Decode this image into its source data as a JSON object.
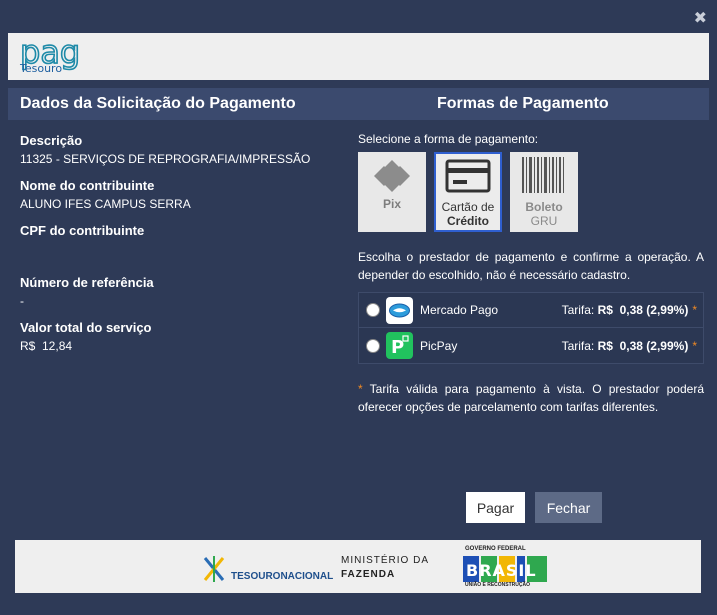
{
  "window": {
    "close_label": "✖"
  },
  "logo": {
    "brand": "pag",
    "sub": "Tesouro"
  },
  "headers": {
    "left": "Dados da Solicitação do Pagamento",
    "right": "Formas de Pagamento"
  },
  "details": {
    "descricao_label": "Descrição",
    "descricao_value": "11325 - SERVIÇOS DE REPROGRAFIA/IMPRESSÃO",
    "nome_label": "Nome do contribuinte",
    "nome_value": "ALUNO IFES CAMPUS SERRA",
    "cpf_label": "CPF do contribuinte",
    "cpf_value": "",
    "ref_label": "Número de referência",
    "ref_value": "-",
    "valor_label": "Valor total do serviço",
    "valor_value": "R$  12,84"
  },
  "payment": {
    "select_label": "Selecione a forma de pagamento:",
    "methods": {
      "pix": "Pix",
      "credit_line1": "Cartão de",
      "credit_line2": "Crédito",
      "boleto_line1": "Boleto",
      "boleto_line2": "GRU"
    },
    "selected": "credit",
    "instructions": "Escolha o prestador de pagamento e confirme a operação. A depender do escolhido, não é necessário cadastro.",
    "providers": [
      {
        "name": "Mercado Pago",
        "fee_prefix": "Tarifa: ",
        "fee_currency": "R$",
        "fee_value": "0,38 (2,99%)",
        "asterisk": "*"
      },
      {
        "name": "PicPay",
        "fee_prefix": "Tarifa: ",
        "fee_currency": "R$",
        "fee_value": "0,38 (2,99%)",
        "asterisk": "*"
      }
    ],
    "footnote_ast": "*",
    "footnote": "Tarifa válida para pagamento à vista. O prestador poderá oferecer opções de parcelamento com tarifas diferentes."
  },
  "buttons": {
    "pagar": "Pagar",
    "fechar": "Fechar"
  },
  "footer": {
    "tesouro_nacional": "TESOURONACIONAL",
    "ministerio": "MINISTÉRIO DA",
    "fazenda": "FAZENDA",
    "gov_top": "GOVERNO FEDERAL",
    "brasil": "BRASIL",
    "gov_bottom": "UNIÃO E RECONSTRUÇÃO"
  },
  "colors": {
    "background": "#2e3a57",
    "accent": "#2f5fd0",
    "asterisk": "#f08a24"
  }
}
